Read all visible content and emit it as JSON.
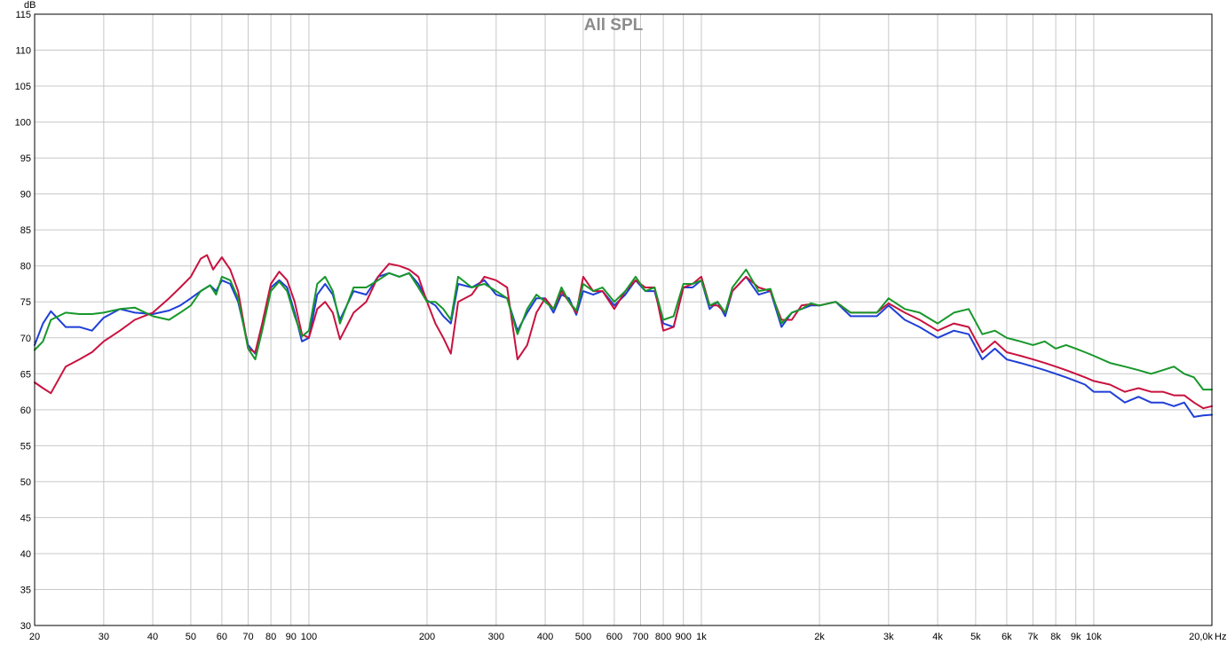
{
  "chart_data": {
    "type": "line",
    "title": "All SPL",
    "ylabel": "dB",
    "xlabel_unit": "Hz",
    "x_scale": "log",
    "xlim": [
      20,
      20000
    ],
    "ylim": [
      30,
      115
    ],
    "grid": true,
    "legend": "none",
    "y_ticks": [
      30,
      35,
      40,
      45,
      50,
      55,
      60,
      65,
      70,
      75,
      80,
      85,
      90,
      95,
      100,
      105,
      110,
      115
    ],
    "x_ticks": [
      {
        "value": 20,
        "label": "20"
      },
      {
        "value": 30,
        "label": "30"
      },
      {
        "value": 40,
        "label": "40"
      },
      {
        "value": 50,
        "label": "50"
      },
      {
        "value": 60,
        "label": "60"
      },
      {
        "value": 70,
        "label": "70"
      },
      {
        "value": 80,
        "label": "80"
      },
      {
        "value": 90,
        "label": "90"
      },
      {
        "value": 100,
        "label": "100"
      },
      {
        "value": 200,
        "label": "200"
      },
      {
        "value": 300,
        "label": "300"
      },
      {
        "value": 400,
        "label": "400"
      },
      {
        "value": 500,
        "label": "500"
      },
      {
        "value": 600,
        "label": "600"
      },
      {
        "value": 700,
        "label": "700"
      },
      {
        "value": 800,
        "label": "800"
      },
      {
        "value": 900,
        "label": "900"
      },
      {
        "value": 1000,
        "label": "1k"
      },
      {
        "value": 2000,
        "label": "2k"
      },
      {
        "value": 3000,
        "label": "3k"
      },
      {
        "value": 4000,
        "label": "4k"
      },
      {
        "value": 5000,
        "label": "5k"
      },
      {
        "value": 6000,
        "label": "6k"
      },
      {
        "value": 7000,
        "label": "7k"
      },
      {
        "value": 8000,
        "label": "8k"
      },
      {
        "value": 9000,
        "label": "9k"
      },
      {
        "value": 10000,
        "label": "10k"
      },
      {
        "value": 20000,
        "label": "20,0k"
      }
    ],
    "series": [
      {
        "color": "#1f3fd6",
        "x": [
          20,
          21,
          22,
          24,
          26,
          28,
          30,
          33,
          36,
          40,
          44,
          47,
          50,
          53,
          56,
          58,
          60,
          63,
          66,
          70,
          73,
          76,
          80,
          84,
          88,
          92,
          96,
          100,
          105,
          110,
          115,
          120,
          130,
          140,
          150,
          160,
          170,
          180,
          190,
          200,
          210,
          220,
          230,
          240,
          260,
          280,
          300,
          320,
          340,
          360,
          380,
          400,
          420,
          440,
          460,
          480,
          500,
          530,
          560,
          600,
          640,
          680,
          720,
          760,
          800,
          850,
          900,
          950,
          1000,
          1050,
          1100,
          1150,
          1200,
          1300,
          1400,
          1500,
          1600,
          1700,
          1800,
          1900,
          2000,
          2200,
          2400,
          2600,
          2800,
          3000,
          3300,
          3600,
          4000,
          4400,
          4800,
          5200,
          5600,
          6000,
          6500,
          7000,
          7500,
          8000,
          8500,
          9000,
          9500,
          10000,
          11000,
          12000,
          13000,
          14000,
          15000,
          16000,
          17000,
          18000,
          19000,
          20000
        ],
        "y": [
          69,
          72,
          73.7,
          71.5,
          71.5,
          71.0,
          72.8,
          74.0,
          73.5,
          73.3,
          73.8,
          74.5,
          75.5,
          76.5,
          77.3,
          76.5,
          78.0,
          77.5,
          75.0,
          69.0,
          67.8,
          71.5,
          77.0,
          78.0,
          77.0,
          73.5,
          69.5,
          70.0,
          76.0,
          77.5,
          76.0,
          72.5,
          76.5,
          76.0,
          78.5,
          79.0,
          78.5,
          79.0,
          77.5,
          75.2,
          74.5,
          73.0,
          72.0,
          77.5,
          77.0,
          78.0,
          76.0,
          75.5,
          71.0,
          73.5,
          75.5,
          75.5,
          73.5,
          76.0,
          75.5,
          73.2,
          76.5,
          76.0,
          76.5,
          74.5,
          76.0,
          78.0,
          76.5,
          76.5,
          72.0,
          71.5,
          77.0,
          77.0,
          78.0,
          74.0,
          75.0,
          73.0,
          76.5,
          78.5,
          76.0,
          76.5,
          71.5,
          73.5,
          74.0,
          74.5,
          74.5,
          75.0,
          73.0,
          73.0,
          73.0,
          74.5,
          72.5,
          71.5,
          70.0,
          71.0,
          70.5,
          67.0,
          68.5,
          67.0,
          66.5,
          66.0,
          65.5,
          65.0,
          64.5,
          64.0,
          63.5,
          62.5,
          62.5,
          61.0,
          61.8,
          61.0,
          61.0,
          60.5,
          61.0,
          59.0,
          59.2,
          59.3
        ]
      },
      {
        "color": "#c8123f",
        "x": [
          20,
          21,
          22,
          24,
          26,
          28,
          30,
          33,
          36,
          40,
          44,
          47,
          50,
          53,
          55,
          57,
          60,
          63,
          66,
          70,
          73,
          76,
          80,
          84,
          88,
          92,
          96,
          100,
          105,
          110,
          115,
          120,
          130,
          140,
          150,
          160,
          170,
          180,
          190,
          200,
          210,
          220,
          230,
          240,
          260,
          280,
          300,
          320,
          340,
          360,
          380,
          400,
          420,
          440,
          460,
          480,
          500,
          530,
          560,
          600,
          640,
          680,
          720,
          760,
          800,
          850,
          900,
          950,
          1000,
          1050,
          1100,
          1150,
          1200,
          1300,
          1400,
          1500,
          1600,
          1700,
          1800,
          1900,
          2000,
          2200,
          2400,
          2600,
          2800,
          3000,
          3300,
          3600,
          4000,
          4400,
          4800,
          5200,
          5600,
          6000,
          6500,
          7000,
          7500,
          8000,
          8500,
          9000,
          9500,
          10000,
          11000,
          12000,
          13000,
          14000,
          15000,
          16000,
          17000,
          18000,
          19000,
          20000
        ],
        "y": [
          63.8,
          63.0,
          62.3,
          66.0,
          67.0,
          68.0,
          69.5,
          71.0,
          72.5,
          73.5,
          75.5,
          77.0,
          78.5,
          81.0,
          81.5,
          79.5,
          81.2,
          79.5,
          76.5,
          68.5,
          68.0,
          72.0,
          77.5,
          79.2,
          78.0,
          75.0,
          70.5,
          70.0,
          74.0,
          75.0,
          73.5,
          69.8,
          73.5,
          75.0,
          78.5,
          80.3,
          80.0,
          79.5,
          78.5,
          75.0,
          72.0,
          70.0,
          67.8,
          75.0,
          76.0,
          78.5,
          78.0,
          77.0,
          67.0,
          69.0,
          73.5,
          75.5,
          74.0,
          76.5,
          75.0,
          73.5,
          78.5,
          76.5,
          76.5,
          74.0,
          76.5,
          78.0,
          77.0,
          77.0,
          71.0,
          71.5,
          77.0,
          77.5,
          78.5,
          74.5,
          74.5,
          73.5,
          76.5,
          78.5,
          77.0,
          76.5,
          72.5,
          72.5,
          74.5,
          74.7,
          74.5,
          75.0,
          73.5,
          73.5,
          73.5,
          74.8,
          73.5,
          72.5,
          71.0,
          72.0,
          71.5,
          68.0,
          69.5,
          68.0,
          67.5,
          67.0,
          66.5,
          66.0,
          65.5,
          65.0,
          64.5,
          64.0,
          63.5,
          62.5,
          63.0,
          62.5,
          62.5,
          62.0,
          62.0,
          61.0,
          60.2,
          60.5
        ]
      },
      {
        "color": "#17972a",
        "x": [
          20,
          21,
          22,
          24,
          26,
          28,
          30,
          33,
          36,
          40,
          44,
          47,
          50,
          53,
          56,
          58,
          60,
          63,
          66,
          70,
          73,
          76,
          80,
          84,
          88,
          92,
          96,
          100,
          105,
          110,
          115,
          120,
          130,
          140,
          150,
          160,
          170,
          180,
          190,
          200,
          210,
          220,
          230,
          240,
          260,
          280,
          300,
          320,
          340,
          360,
          380,
          400,
          420,
          440,
          460,
          480,
          500,
          530,
          560,
          600,
          640,
          680,
          720,
          760,
          800,
          850,
          900,
          950,
          1000,
          1050,
          1100,
          1150,
          1200,
          1300,
          1400,
          1500,
          1600,
          1700,
          1800,
          1900,
          2000,
          2200,
          2400,
          2600,
          2800,
          3000,
          3300,
          3600,
          4000,
          4400,
          4800,
          5200,
          5600,
          6000,
          6500,
          7000,
          7500,
          8000,
          8500,
          9000,
          9500,
          10000,
          11000,
          12000,
          13000,
          14000,
          15000,
          16000,
          17000,
          18000,
          19000,
          20000
        ],
        "y": [
          68.3,
          69.5,
          72.5,
          73.5,
          73.3,
          73.3,
          73.5,
          74.0,
          74.2,
          73.0,
          72.5,
          73.5,
          74.5,
          76.5,
          77.3,
          76.0,
          78.5,
          78.0,
          75.5,
          68.5,
          67.0,
          71.0,
          76.5,
          77.8,
          76.5,
          73.0,
          70.2,
          71.0,
          77.5,
          78.5,
          76.5,
          72.0,
          77.0,
          77.0,
          78.0,
          79.0,
          78.5,
          79.0,
          77.0,
          75.0,
          75.0,
          74.0,
          72.5,
          78.5,
          77.0,
          77.5,
          76.5,
          75.5,
          70.5,
          74.0,
          76.0,
          75.0,
          74.0,
          77.0,
          75.0,
          73.8,
          77.5,
          76.5,
          77.0,
          75.0,
          76.5,
          78.5,
          76.5,
          77.0,
          72.5,
          73.0,
          77.5,
          77.5,
          78.0,
          74.5,
          75.0,
          73.5,
          77.0,
          79.5,
          76.5,
          76.8,
          72.0,
          73.5,
          74.0,
          74.8,
          74.5,
          75.0,
          73.5,
          73.5,
          73.5,
          75.5,
          74.0,
          73.5,
          72.0,
          73.5,
          74.0,
          70.5,
          71.0,
          70.0,
          69.5,
          69.0,
          69.5,
          68.5,
          69.0,
          68.5,
          68.0,
          67.5,
          66.5,
          66.0,
          65.5,
          65.0,
          65.5,
          66.0,
          65.0,
          64.5,
          62.8,
          62.8
        ]
      }
    ]
  }
}
